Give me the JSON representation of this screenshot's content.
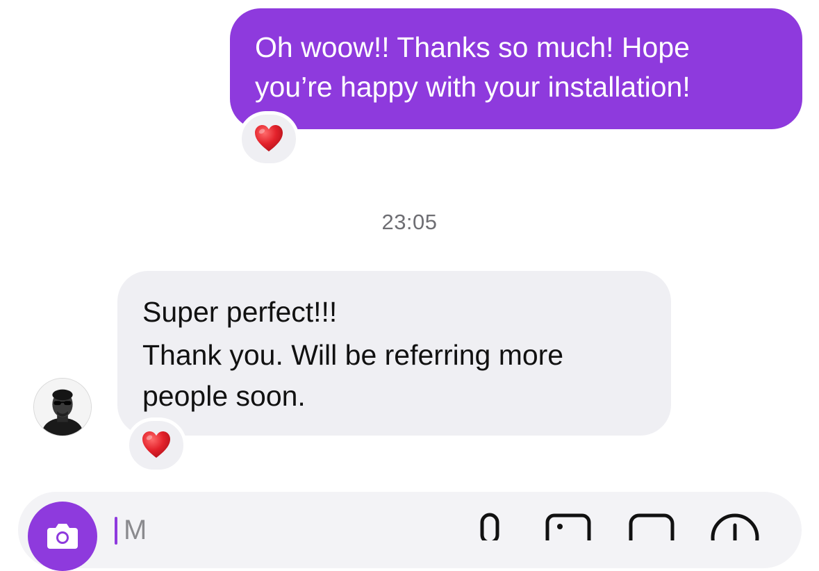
{
  "thread": {
    "sent_message": {
      "lines": [
        "Oh woow!! Thanks so much! Hope",
        "you’re happy with your installation!"
      ],
      "reaction": "❤️"
    },
    "timestamp": "23:05",
    "received_message": {
      "lines": [
        "Super perfect!!!",
        "Thank you. Will be referring more",
        "people soon."
      ],
      "reaction": "❤️"
    }
  },
  "composer": {
    "placeholder": "M"
  },
  "colors": {
    "accent": "#8E3ADD",
    "received_bubble": "#EFEFF3",
    "timestamp": "#6E6E73"
  },
  "icons": {
    "camera": "camera-icon",
    "microphone": "microphone-icon",
    "gallery": "gallery-icon",
    "sticker": "sticker-icon",
    "add": "add-circle-icon",
    "reaction": "red-heart-icon"
  }
}
